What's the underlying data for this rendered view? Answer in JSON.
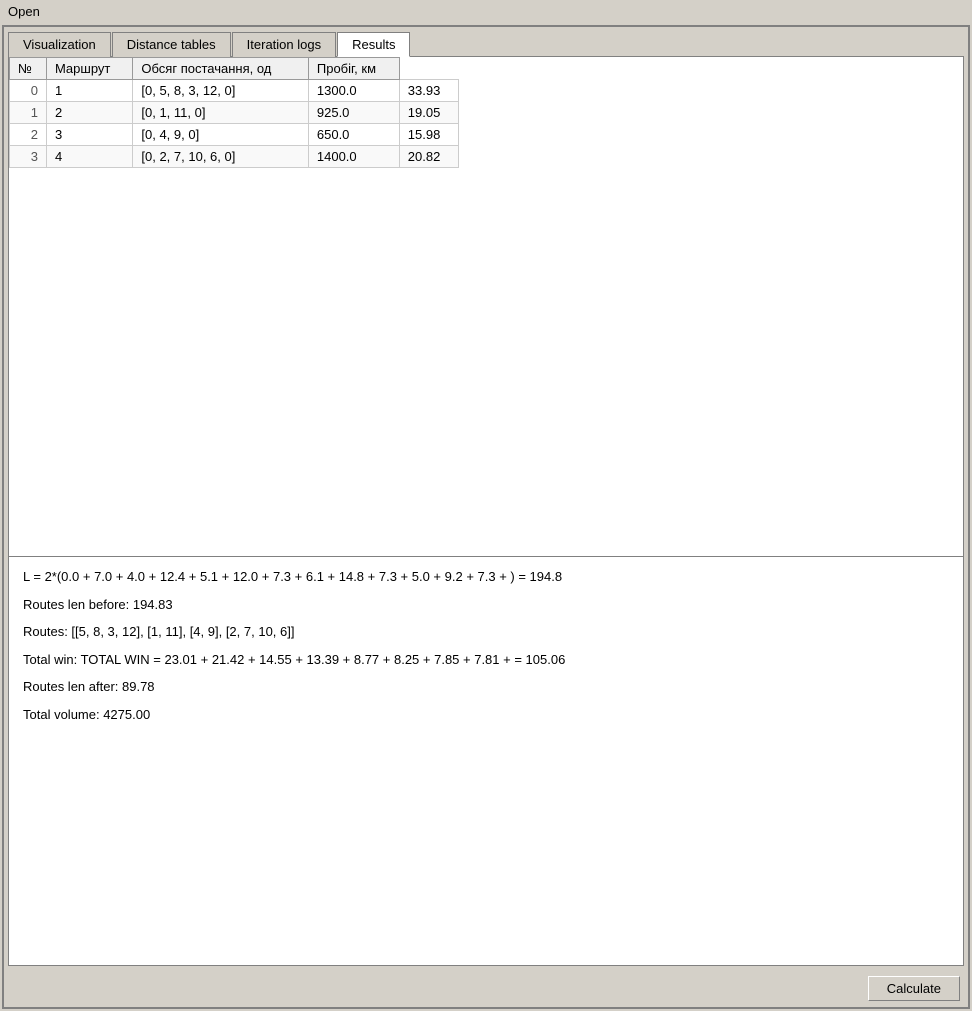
{
  "title_bar": {
    "label": "Open"
  },
  "tabs": [
    {
      "id": "visualization",
      "label": "Visualization",
      "active": false
    },
    {
      "id": "distance-tables",
      "label": "Distance tables",
      "active": false
    },
    {
      "id": "iteration-logs",
      "label": "Iteration logs",
      "active": false
    },
    {
      "id": "results",
      "label": "Results",
      "active": true
    }
  ],
  "table": {
    "headers": [
      "№",
      "Маршрут",
      "Обсяг постачання, од",
      "Пробіг, км"
    ],
    "rows": [
      {
        "idx": "0",
        "num": "1",
        "route": "[0, 5, 8, 3, 12, 0]",
        "volume": "1300.0",
        "distance": "33.93"
      },
      {
        "idx": "1",
        "num": "2",
        "route": "[0, 1, 11, 0]",
        "volume": "925.0",
        "distance": "19.05"
      },
      {
        "idx": "2",
        "num": "3",
        "route": "[0, 4, 9, 0]",
        "volume": "650.0",
        "distance": "15.98"
      },
      {
        "idx": "3",
        "num": "4",
        "route": "[0, 2, 7, 10, 6, 0]",
        "volume": "1400.0",
        "distance": "20.82"
      }
    ]
  },
  "summary": {
    "formula": "L = 2*(0.0 + 7.0 + 4.0 + 12.4 + 5.1 + 12.0 + 7.3 + 6.1 + 14.8 + 7.3 + 5.0 + 9.2 + 7.3 + ) = 194.8",
    "routes_len_before": "Routes len before: 194.83",
    "routes": "Routes: [[5, 8, 3, 12], [1, 11], [4, 9], [2, 7, 10, 6]]",
    "total_win": "Total win: TOTAL WIN = 23.01 + 21.42 + 14.55 + 13.39 + 8.77 + 8.25 + 7.85 + 7.81 + = 105.06",
    "routes_len_after": "Routes len after: 89.78",
    "total_volume": "Total volume: 4275.00"
  },
  "footer": {
    "calculate_button": "Calculate"
  }
}
